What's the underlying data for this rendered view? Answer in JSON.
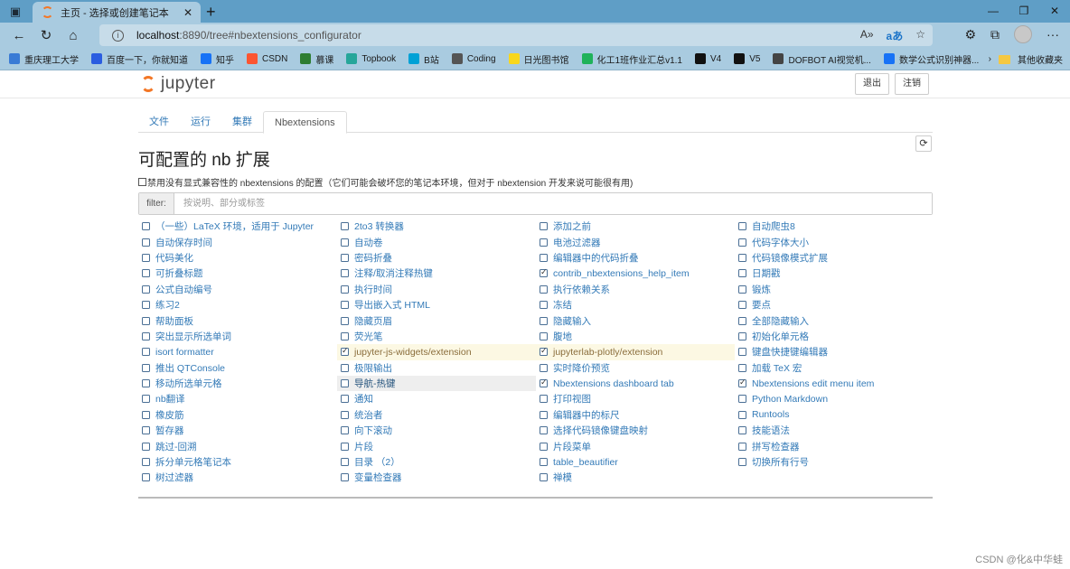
{
  "browser": {
    "tab_title": "主页 - 选择或创建笔记本",
    "url_host": "localhost",
    "url_rest": ":8890/tree#nbextensions_configurator",
    "bookmarks": [
      {
        "label": "重庆理工大学",
        "icon": "globe-icon",
        "color": "#3a7bd5"
      },
      {
        "label": "百度一下，你就知道",
        "icon": "paw-icon",
        "color": "#2b5de0"
      },
      {
        "label": "知乎",
        "icon": "zhihu-icon",
        "color": "#1772f6"
      },
      {
        "label": "CSDN",
        "icon": "csdn-icon",
        "color": "#fc5531"
      },
      {
        "label": "慕课",
        "icon": "mooc-icon",
        "color": "#2e7d32"
      },
      {
        "label": "Topbook",
        "icon": "topbook-icon",
        "color": "#26a69a"
      },
      {
        "label": "B站",
        "icon": "bilibili-icon",
        "color": "#00a1d6"
      },
      {
        "label": "Coding",
        "icon": "coding-icon",
        "color": "#555555"
      },
      {
        "label": "日光图书馆",
        "icon": "sun-icon",
        "color": "#f9d71c"
      },
      {
        "label": "化工1班作业汇总v1.1",
        "icon": "sheet-icon",
        "color": "#1fb25a"
      },
      {
        "label": "V4",
        "icon": "github-icon",
        "color": "#111111"
      },
      {
        "label": "V5",
        "icon": "github-icon",
        "color": "#111111"
      },
      {
        "label": "DOFBOT AI视觉机...",
        "icon": "robot-icon",
        "color": "#444444"
      },
      {
        "label": "数学公式识别神器...",
        "icon": "zhihu-icon",
        "color": "#1772f6"
      }
    ],
    "other_bookmarks": "其他收藏夹"
  },
  "jupyter": {
    "logo_text": "jupyter",
    "quit_label": "退出",
    "logout_label": "注销",
    "tabs": [
      {
        "label": "文件",
        "active": false
      },
      {
        "label": "运行",
        "active": false
      },
      {
        "label": "集群",
        "active": false
      },
      {
        "label": "Nbextensions",
        "active": true
      }
    ],
    "page_title": "可配置的 nb 扩展",
    "compat_label": "禁用没有显式兼容性的 nbextensions 的配置（它们可能会破坏您的笔记本环境，但对于 nbextension 开发来说可能很有用)",
    "filter_label": "filter:",
    "filter_placeholder": "按说明、部分或标签",
    "extensions": [
      {
        "label": "（一些）LaTeX 环境，适用于 Jupyter",
        "checked": false,
        "state": "normal"
      },
      {
        "label": "自动保存时间",
        "checked": false,
        "state": "normal"
      },
      {
        "label": "代码美化",
        "checked": false,
        "state": "normal"
      },
      {
        "label": "可折叠标题",
        "checked": false,
        "state": "normal"
      },
      {
        "label": "公式自动编号",
        "checked": false,
        "state": "normal"
      },
      {
        "label": "练习2",
        "checked": false,
        "state": "normal"
      },
      {
        "label": "帮助面板",
        "checked": false,
        "state": "normal"
      },
      {
        "label": "突出显示所选单词",
        "checked": false,
        "state": "normal"
      },
      {
        "label": "isort formatter",
        "checked": false,
        "state": "normal"
      },
      {
        "label": "推出 QTConsole",
        "checked": false,
        "state": "normal"
      },
      {
        "label": "移动所选单元格",
        "checked": false,
        "state": "normal"
      },
      {
        "label": "nb翻译",
        "checked": false,
        "state": "normal"
      },
      {
        "label": "橡皮筋",
        "checked": false,
        "state": "normal"
      },
      {
        "label": "暂存器",
        "checked": false,
        "state": "normal"
      },
      {
        "label": "跳过-回溯",
        "checked": false,
        "state": "normal"
      },
      {
        "label": "拆分单元格笔记本",
        "checked": false,
        "state": "normal"
      },
      {
        "label": "树过滤器",
        "checked": false,
        "state": "normal"
      },
      {
        "label": "2to3 转换器",
        "checked": false,
        "state": "normal"
      },
      {
        "label": "自动卷",
        "checked": false,
        "state": "normal"
      },
      {
        "label": "密码折叠",
        "checked": false,
        "state": "normal"
      },
      {
        "label": "注释/取消注释热键",
        "checked": false,
        "state": "normal"
      },
      {
        "label": "执行时间",
        "checked": false,
        "state": "normal"
      },
      {
        "label": "导出嵌入式 HTML",
        "checked": false,
        "state": "normal"
      },
      {
        "label": "隐藏页眉",
        "checked": false,
        "state": "normal"
      },
      {
        "label": "荧光笔",
        "checked": false,
        "state": "normal"
      },
      {
        "label": "jupyter-js-widgets/extension",
        "checked": true,
        "state": "incompat"
      },
      {
        "label": "极限输出",
        "checked": false,
        "state": "normal"
      },
      {
        "label": "导航-热键",
        "checked": false,
        "state": "hover"
      },
      {
        "label": "通知",
        "checked": false,
        "state": "normal"
      },
      {
        "label": "统治者",
        "checked": false,
        "state": "normal"
      },
      {
        "label": "向下滚动",
        "checked": false,
        "state": "normal"
      },
      {
        "label": "片段",
        "checked": false,
        "state": "normal"
      },
      {
        "label": "目录 （2）",
        "checked": false,
        "state": "normal"
      },
      {
        "label": "变量检查器",
        "checked": false,
        "state": "normal"
      },
      {
        "label": "添加之前",
        "checked": false,
        "state": "normal"
      },
      {
        "label": "电池过滤器",
        "checked": false,
        "state": "normal"
      },
      {
        "label": "编辑器中的代码折叠",
        "checked": false,
        "state": "normal"
      },
      {
        "label": "contrib_nbextensions_help_item",
        "checked": true,
        "state": "normal"
      },
      {
        "label": "执行依赖关系",
        "checked": false,
        "state": "normal"
      },
      {
        "label": "冻结",
        "checked": false,
        "state": "normal"
      },
      {
        "label": "隐藏输入",
        "checked": false,
        "state": "normal"
      },
      {
        "label": "腹地",
        "checked": false,
        "state": "normal"
      },
      {
        "label": "jupyterlab-plotly/extension",
        "checked": true,
        "state": "incompat"
      },
      {
        "label": "实时降价预览",
        "checked": false,
        "state": "normal"
      },
      {
        "label": "Nbextensions dashboard tab",
        "checked": true,
        "state": "normal"
      },
      {
        "label": "打印视图",
        "checked": false,
        "state": "normal"
      },
      {
        "label": "编辑器中的标尺",
        "checked": false,
        "state": "normal"
      },
      {
        "label": "选择代码镜像键盘映射",
        "checked": false,
        "state": "normal"
      },
      {
        "label": "片段菜单",
        "checked": false,
        "state": "normal"
      },
      {
        "label": "table_beautifier",
        "checked": false,
        "state": "normal"
      },
      {
        "label": "禅模",
        "checked": false,
        "state": "normal"
      },
      {
        "label": "自动爬虫8",
        "checked": false,
        "state": "normal"
      },
      {
        "label": "代码字体大小",
        "checked": false,
        "state": "normal"
      },
      {
        "label": "代码镜像模式扩展",
        "checked": false,
        "state": "normal"
      },
      {
        "label": "日期戳",
        "checked": false,
        "state": "normal"
      },
      {
        "label": "锻炼",
        "checked": false,
        "state": "normal"
      },
      {
        "label": "要点",
        "checked": false,
        "state": "normal"
      },
      {
        "label": "全部隐藏输入",
        "checked": false,
        "state": "normal"
      },
      {
        "label": "初始化单元格",
        "checked": false,
        "state": "normal"
      },
      {
        "label": "键盘快捷键编辑器",
        "checked": false,
        "state": "normal"
      },
      {
        "label": "加载 TeX 宏",
        "checked": false,
        "state": "normal"
      },
      {
        "label": "Nbextensions edit menu item",
        "checked": true,
        "state": "normal"
      },
      {
        "label": "Python Markdown",
        "checked": false,
        "state": "normal"
      },
      {
        "label": "Runtools",
        "checked": false,
        "state": "normal"
      },
      {
        "label": "技能语法",
        "checked": false,
        "state": "normal"
      },
      {
        "label": "拼写检查器",
        "checked": false,
        "state": "normal"
      },
      {
        "label": "切换所有行号",
        "checked": false,
        "state": "normal"
      }
    ]
  },
  "watermark": "CSDN @化&中华蛙"
}
